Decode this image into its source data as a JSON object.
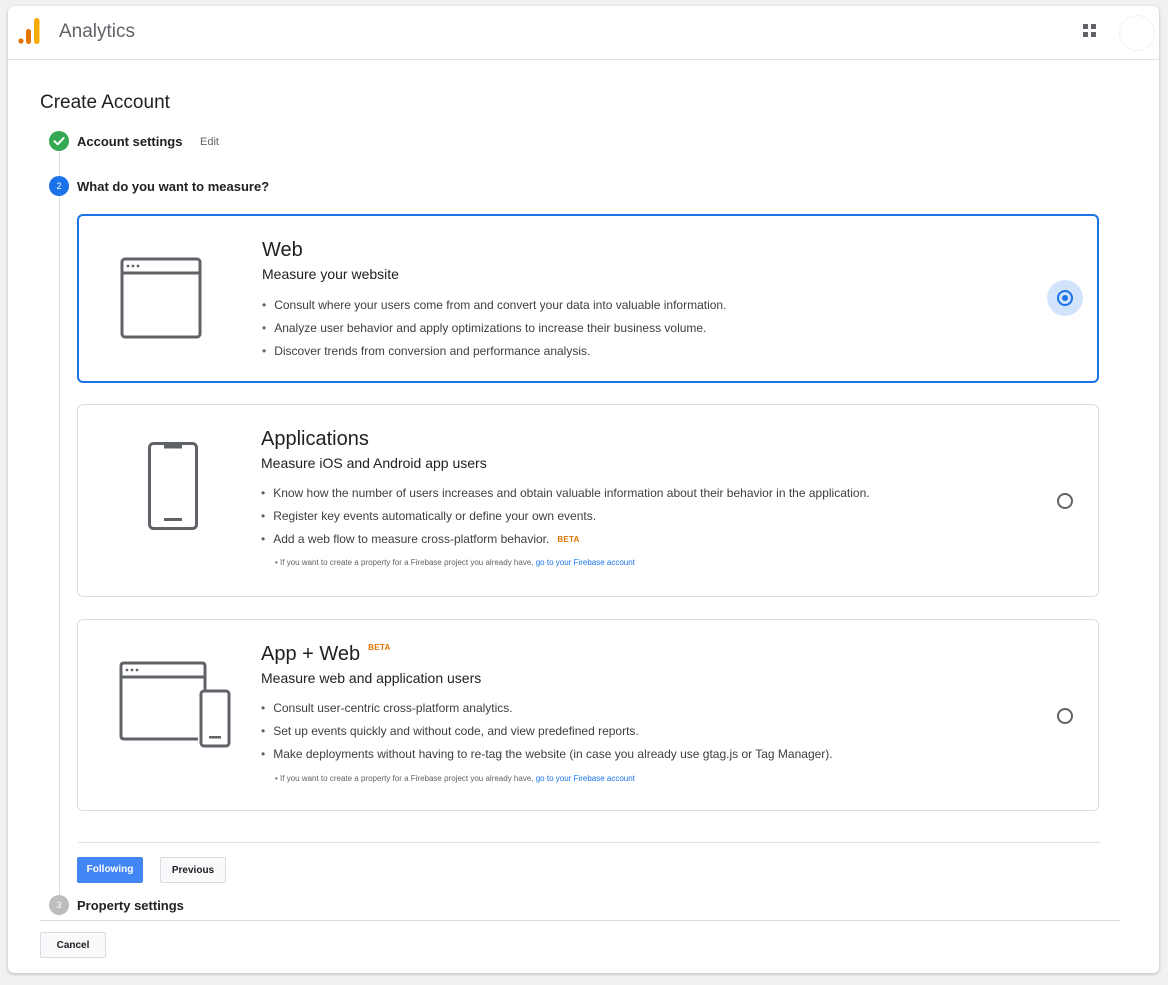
{
  "app": {
    "title": "Analytics",
    "logo_colors": [
      "#f9ab00",
      "#e37400"
    ],
    "accent": "#1a73e8"
  },
  "page": {
    "title": "Create Account"
  },
  "steps": [
    {
      "number": "1",
      "label": "Account settings",
      "action": "Edit",
      "status": "complete"
    },
    {
      "number": "2",
      "label": "What do you want to measure?",
      "status": "active"
    },
    {
      "number": "3",
      "label": "Property settings",
      "status": "pending"
    }
  ],
  "options": {
    "web": {
      "title": "Web",
      "subtitle": "Measure your website",
      "icon": "browser-window-icon",
      "selected": true,
      "bullets": [
        "Consult where your users come from and convert your data into valuable information.",
        "Analyze user behavior and apply optimizations to increase their business volume.",
        "Discover trends from conversion and performance analysis."
      ]
    },
    "apps": {
      "title": "Applications",
      "subtitle": "Measure iOS and Android app users",
      "icon": "smartphone-icon",
      "selected": false,
      "bullets": [
        "Know how the number of users increases and obtain valuable information about their behavior in the application.",
        "Register key events automatically or define your own events.",
        "Add a web flow to measure cross-platform behavior."
      ],
      "bullet3_badge": "BETA",
      "note": "• If you want to create a property for a Firebase project you already have,",
      "note_link": "go to your Firebase account"
    },
    "appweb": {
      "title": "App + Web",
      "badge": "BETA",
      "subtitle": "Measure web and application users",
      "icon": "browser-and-phone-icon",
      "selected": false,
      "bullets": [
        "Consult user-centric cross-platform analytics.",
        "Set up events quickly and without code, and view predefined reports.",
        "Make deployments without having to re-tag the website (in case you already use gtag.js or Tag Manager)."
      ],
      "note": "• If you want to create a property for a Firebase project you already have,",
      "note_link": "go to your Firebase account"
    }
  },
  "buttons": {
    "next": "Following",
    "previous": "Previous",
    "cancel": "Cancel"
  }
}
